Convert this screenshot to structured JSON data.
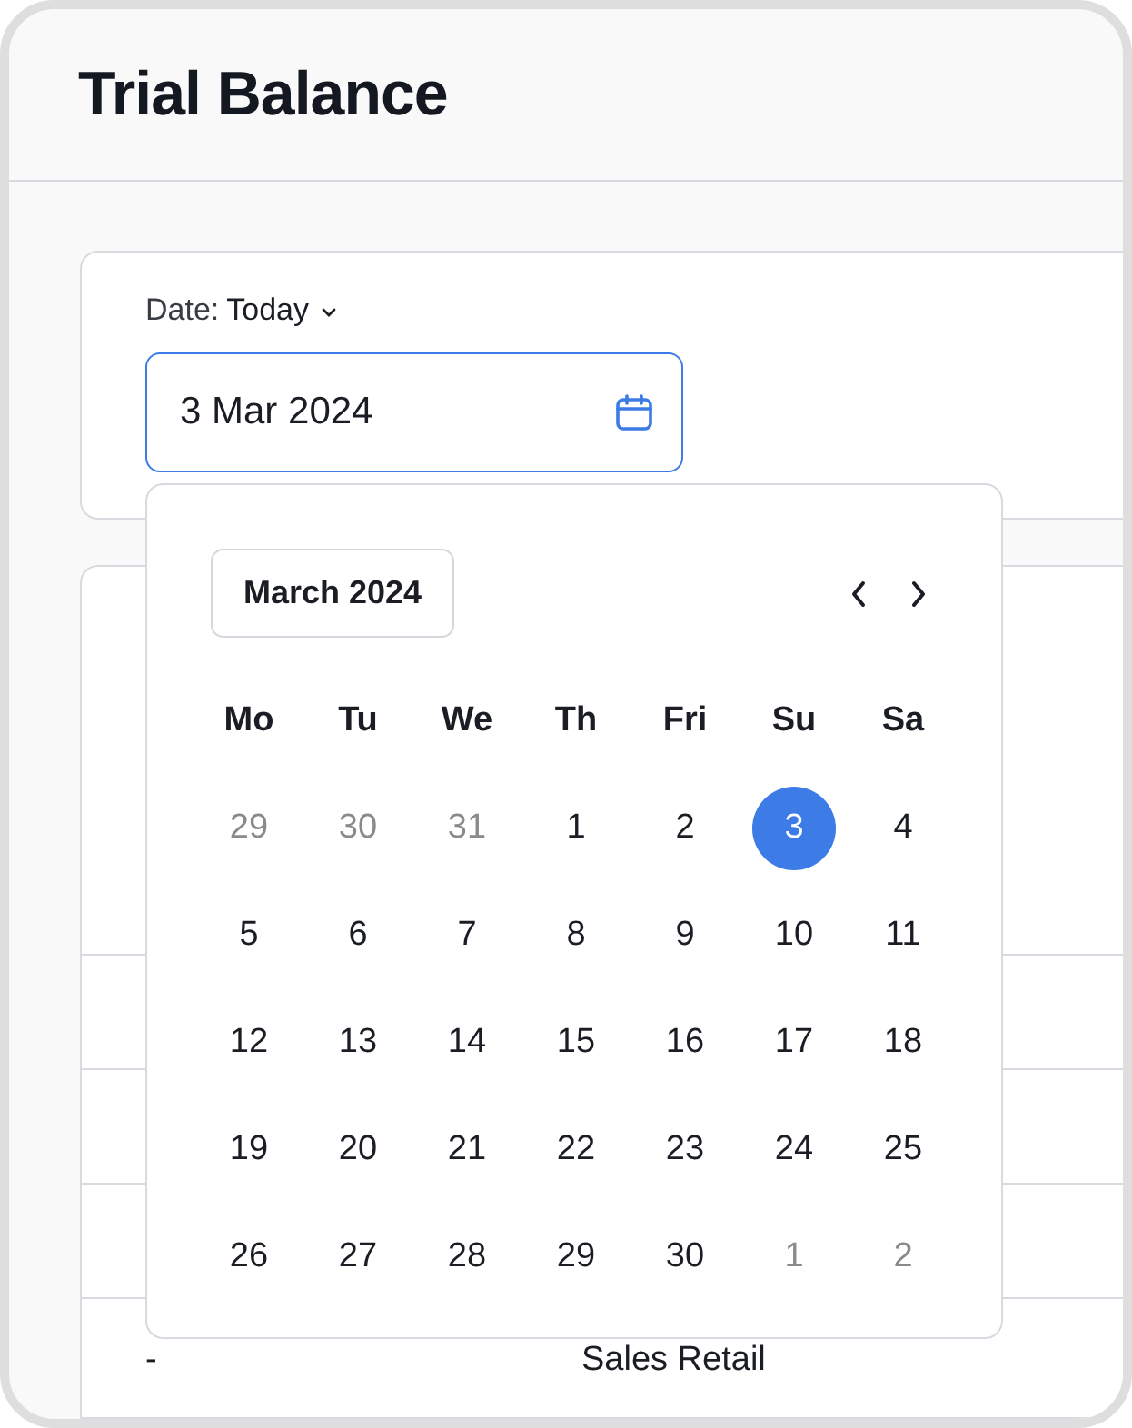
{
  "page": {
    "title": "Trial Balance"
  },
  "filter": {
    "label": "Date:",
    "preset": "Today",
    "value": "3 Mar 2024",
    "focused": true
  },
  "calendar": {
    "month_label": "March 2024",
    "weekdays": [
      "Mo",
      "Tu",
      "We",
      "Th",
      "Fri",
      "Su",
      "Sa"
    ],
    "days": [
      {
        "label": "29",
        "in_month": false,
        "selected": false
      },
      {
        "label": "30",
        "in_month": false,
        "selected": false
      },
      {
        "label": "31",
        "in_month": false,
        "selected": false
      },
      {
        "label": "1",
        "in_month": true,
        "selected": false
      },
      {
        "label": "2",
        "in_month": true,
        "selected": false
      },
      {
        "label": "3",
        "in_month": true,
        "selected": true
      },
      {
        "label": "4",
        "in_month": true,
        "selected": false
      },
      {
        "label": "5",
        "in_month": true,
        "selected": false
      },
      {
        "label": "6",
        "in_month": true,
        "selected": false
      },
      {
        "label": "7",
        "in_month": true,
        "selected": false
      },
      {
        "label": "8",
        "in_month": true,
        "selected": false
      },
      {
        "label": "9",
        "in_month": true,
        "selected": false
      },
      {
        "label": "10",
        "in_month": true,
        "selected": false
      },
      {
        "label": "11",
        "in_month": true,
        "selected": false
      },
      {
        "label": "12",
        "in_month": true,
        "selected": false
      },
      {
        "label": "13",
        "in_month": true,
        "selected": false
      },
      {
        "label": "14",
        "in_month": true,
        "selected": false
      },
      {
        "label": "15",
        "in_month": true,
        "selected": false
      },
      {
        "label": "16",
        "in_month": true,
        "selected": false
      },
      {
        "label": "17",
        "in_month": true,
        "selected": false
      },
      {
        "label": "18",
        "in_month": true,
        "selected": false
      },
      {
        "label": "19",
        "in_month": true,
        "selected": false
      },
      {
        "label": "20",
        "in_month": true,
        "selected": false
      },
      {
        "label": "21",
        "in_month": true,
        "selected": false
      },
      {
        "label": "22",
        "in_month": true,
        "selected": false
      },
      {
        "label": "23",
        "in_month": true,
        "selected": false
      },
      {
        "label": "24",
        "in_month": true,
        "selected": false
      },
      {
        "label": "25",
        "in_month": true,
        "selected": false
      },
      {
        "label": "26",
        "in_month": true,
        "selected": false
      },
      {
        "label": "27",
        "in_month": true,
        "selected": false
      },
      {
        "label": "28",
        "in_month": true,
        "selected": false
      },
      {
        "label": "29",
        "in_month": true,
        "selected": false
      },
      {
        "label": "30",
        "in_month": true,
        "selected": false
      },
      {
        "label": "1",
        "in_month": false,
        "selected": false
      },
      {
        "label": "2",
        "in_month": false,
        "selected": false
      }
    ]
  },
  "table": {
    "rows": [
      {
        "column_1": "-",
        "column_2": "Sales Retail"
      }
    ]
  }
}
